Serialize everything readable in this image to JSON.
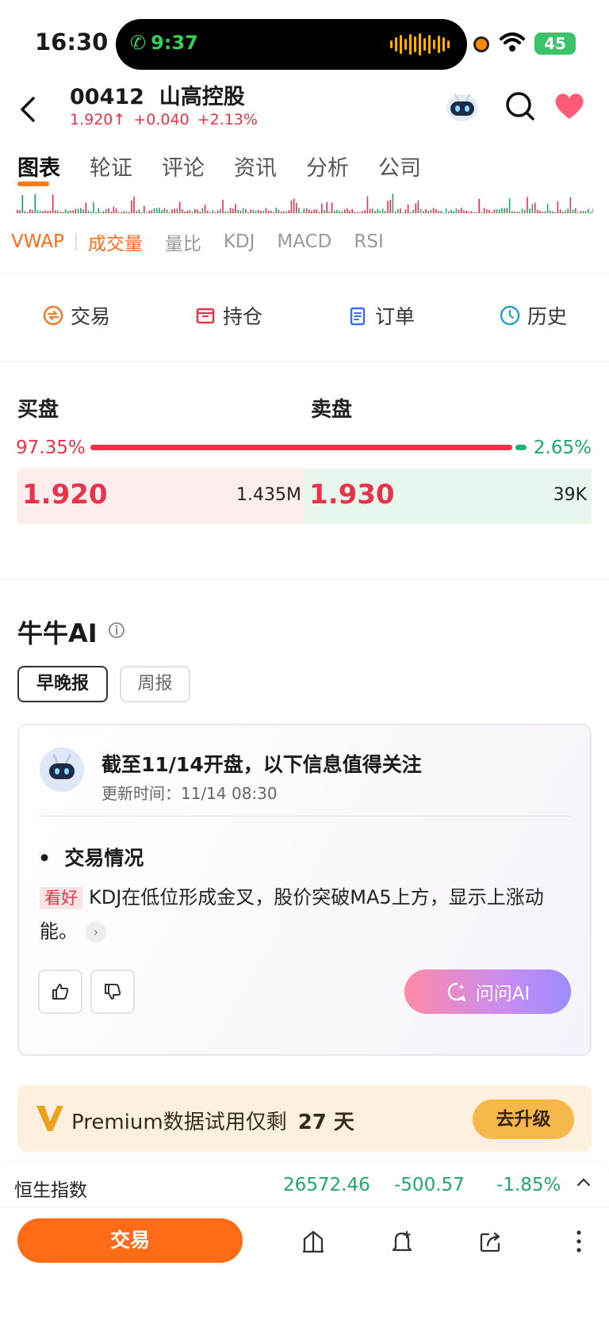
{
  "status_bar": {
    "time": "16:30",
    "call_time": "9:37",
    "battery": "45"
  },
  "header": {
    "code": "00412",
    "name": "山高控股",
    "price": "1.920",
    "arrow": "↑",
    "change": "+0.040",
    "change_pct": "+2.13%"
  },
  "tabs": [
    "图表",
    "轮证",
    "评论",
    "资讯",
    "分析",
    "公司"
  ],
  "indicators": [
    "VWAP",
    "成交量",
    "量比",
    "KDJ",
    "MACD",
    "RSI"
  ],
  "trade_actions": [
    {
      "label": "交易",
      "icon": "trade-icon",
      "color": "#f07b2a"
    },
    {
      "label": "持仓",
      "icon": "position-icon",
      "color": "#e8334a"
    },
    {
      "label": "订单",
      "icon": "order-icon",
      "color": "#3a6ef0"
    },
    {
      "label": "历史",
      "icon": "history-icon",
      "color": "#2aa0c8"
    }
  ],
  "orderbook": {
    "bid_label": "买盘",
    "ask_label": "卖盘",
    "bid_pct": "97.35%",
    "ask_pct": "2.65%",
    "bid_price": "1.920",
    "bid_vol": "1.435M",
    "ask_price": "1.930",
    "ask_vol": "39K"
  },
  "ai": {
    "title": "牛牛AI",
    "pills": [
      "早晚报",
      "周报"
    ],
    "card_title": "截至11/14开盘，以下信息值得关注",
    "update_time": "更新时间：11/14 08:30",
    "section": "交易情况",
    "tag": "看好",
    "text": "KDJ在低位形成金叉，股价突破MA5上方，显示上涨动能。",
    "ask_button": "问问AI"
  },
  "premium": {
    "text": "Premium数据试用仅剩",
    "days": "27 天",
    "button": "去升级"
  },
  "index_ticker": {
    "name": "恒生指数",
    "value": "26572.46",
    "change": "-500.57",
    "pct": "-1.85%"
  },
  "bottom": {
    "trade": "交易"
  },
  "colors": {
    "up": "#e8334a",
    "down": "#20a86a",
    "accent": "#ff6b17"
  }
}
